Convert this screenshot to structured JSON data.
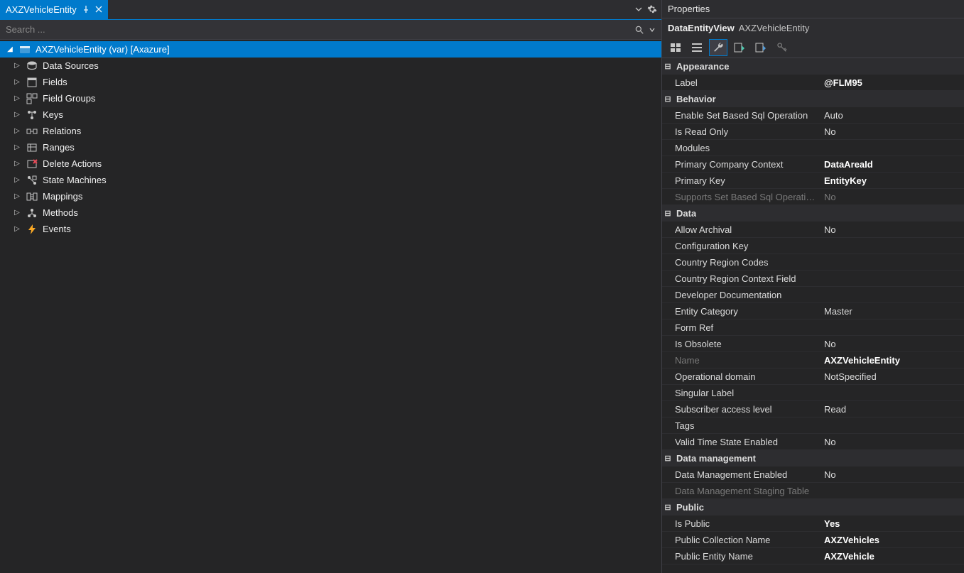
{
  "left": {
    "tab_title": "AXZVehicleEntity",
    "search_placeholder": "Search ...",
    "root": "AXZVehicleEntity (var) [Axazure]",
    "children": [
      {
        "label": "Data Sources",
        "icon": "datasource"
      },
      {
        "label": "Fields",
        "icon": "fields"
      },
      {
        "label": "Field Groups",
        "icon": "fieldgroups"
      },
      {
        "label": "Keys",
        "icon": "keys"
      },
      {
        "label": "Relations",
        "icon": "relations"
      },
      {
        "label": "Ranges",
        "icon": "ranges"
      },
      {
        "label": "Delete Actions",
        "icon": "delete"
      },
      {
        "label": "State Machines",
        "icon": "state"
      },
      {
        "label": "Mappings",
        "icon": "mappings"
      },
      {
        "label": "Methods",
        "icon": "methods"
      },
      {
        "label": "Events",
        "icon": "events"
      }
    ]
  },
  "right": {
    "title": "Properties",
    "obj_type": "DataEntityView",
    "obj_name": "AXZVehicleEntity",
    "categories": [
      {
        "name": "Appearance",
        "rows": [
          {
            "k": "Label",
            "v": "@FLM95",
            "bold": true
          }
        ]
      },
      {
        "name": "Behavior",
        "rows": [
          {
            "k": "Enable Set Based Sql Operation",
            "v": "Auto"
          },
          {
            "k": "Is Read Only",
            "v": "No"
          },
          {
            "k": "Modules",
            "v": ""
          },
          {
            "k": "Primary Company Context",
            "v": "DataAreaId",
            "bold": true
          },
          {
            "k": "Primary Key",
            "v": "EntityKey",
            "bold": true
          },
          {
            "k": "Supports Set Based Sql Operations",
            "v": "No",
            "readonly": true
          }
        ]
      },
      {
        "name": "Data",
        "rows": [
          {
            "k": "Allow Archival",
            "v": "No"
          },
          {
            "k": "Configuration Key",
            "v": ""
          },
          {
            "k": "Country Region Codes",
            "v": ""
          },
          {
            "k": "Country Region Context Field",
            "v": ""
          },
          {
            "k": "Developer Documentation",
            "v": ""
          },
          {
            "k": "Entity Category",
            "v": "Master"
          },
          {
            "k": "Form Ref",
            "v": ""
          },
          {
            "k": "Is Obsolete",
            "v": "No"
          },
          {
            "k": "Name",
            "v": "AXZVehicleEntity",
            "readonly": true,
            "bold": true
          },
          {
            "k": "Operational domain",
            "v": "NotSpecified"
          },
          {
            "k": "Singular Label",
            "v": ""
          },
          {
            "k": "Subscriber access level",
            "v": "Read"
          },
          {
            "k": "Tags",
            "v": ""
          },
          {
            "k": "Valid Time State Enabled",
            "v": "No"
          }
        ]
      },
      {
        "name": "Data management",
        "rows": [
          {
            "k": "Data Management Enabled",
            "v": "No"
          },
          {
            "k": "Data Management Staging Table",
            "v": "",
            "readonly": true
          }
        ]
      },
      {
        "name": "Public",
        "rows": [
          {
            "k": "Is Public",
            "v": "Yes",
            "bold": true
          },
          {
            "k": "Public Collection Name",
            "v": "AXZVehicles",
            "bold": true
          },
          {
            "k": "Public Entity Name",
            "v": "AXZVehicle",
            "bold": true
          }
        ]
      }
    ]
  }
}
